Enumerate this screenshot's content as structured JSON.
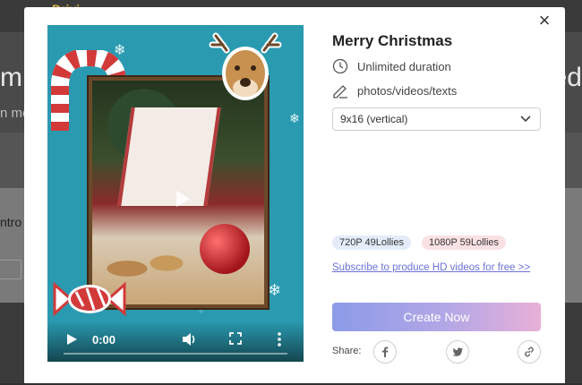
{
  "background": {
    "logo_fragment": "Drivi",
    "hero_left_fragment": "m",
    "hero_right_fragment": "ed",
    "search_fragment": "n me",
    "intro_fragment": "ntro"
  },
  "modal": {
    "title": "Merry Christmas",
    "meta": {
      "duration": "Unlimited duration",
      "media": "photos/videos/texts"
    },
    "aspect_select": {
      "selected": "9x16 (vertical)"
    },
    "prices": {
      "hd720": "720P 49Lollies",
      "hd1080": "1080P 59Lollies"
    },
    "subscribe_text": "Subscribe to produce HD videos for free >>",
    "create_button": "Create Now",
    "share_label": "Share:",
    "player": {
      "time": "0:00"
    }
  },
  "colors": {
    "video_bg": "#2a9ab0",
    "link": "#6b72d6",
    "button_gradient_start": "#8c9be8",
    "button_gradient_end": "#e8b0d8"
  }
}
